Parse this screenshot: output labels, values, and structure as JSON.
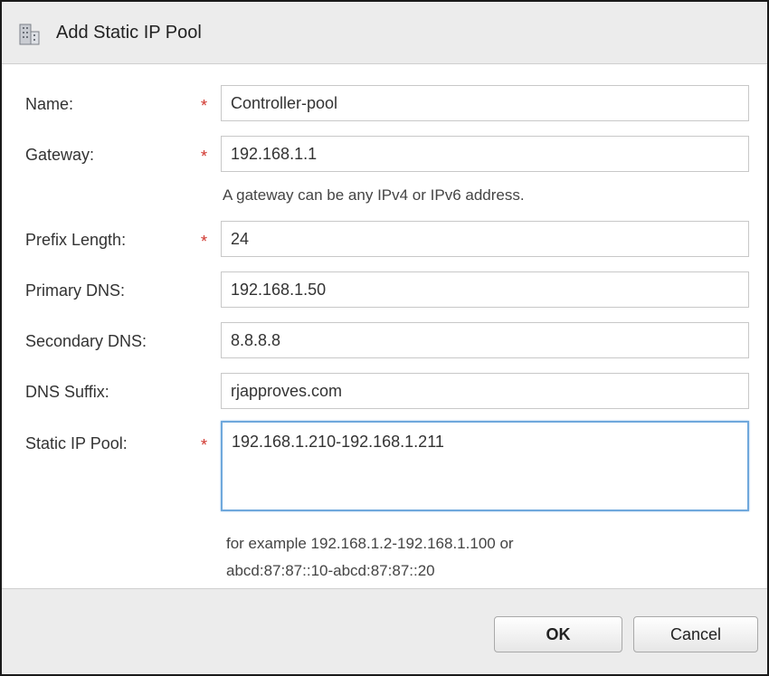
{
  "dialog": {
    "title": "Add Static IP Pool",
    "icon": "building-icon"
  },
  "colors": {
    "required_marker": "#d0342c",
    "focus_border": "#6fa8dc",
    "panel_bg": "#ececec"
  },
  "form": {
    "required_mark": "*",
    "name": {
      "label": "Name:",
      "value": "Controller-pool",
      "required": true
    },
    "gateway": {
      "label": "Gateway:",
      "value": "192.168.1.1",
      "required": true,
      "hint": "A gateway can be any IPv4 or IPv6 address."
    },
    "prefix_length": {
      "label": "Prefix Length:",
      "value": "24",
      "required": true
    },
    "primary_dns": {
      "label": "Primary DNS:",
      "value": "192.168.1.50",
      "required": false
    },
    "secondary_dns": {
      "label": "Secondary DNS:",
      "value": "8.8.8.8",
      "required": false
    },
    "dns_suffix": {
      "label": "DNS Suffix:",
      "value": "rjapproves.com",
      "required": false
    },
    "static_ip_pool": {
      "label": "Static IP Pool:",
      "value": "192.168.1.210-192.168.1.211",
      "required": true,
      "hint_line1": "for example 192.168.1.2-192.168.1.100 or",
      "hint_line2": "abcd:87:87::10-abcd:87:87::20"
    }
  },
  "buttons": {
    "ok": "OK",
    "cancel": "Cancel"
  }
}
